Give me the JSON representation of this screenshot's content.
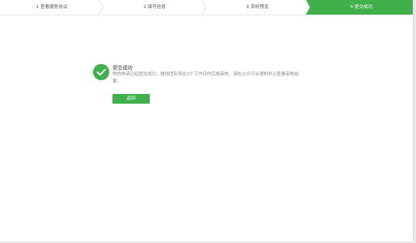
{
  "steps": [
    {
      "label": "1 查看服务协议",
      "active": false
    },
    {
      "label": "2 填写信息",
      "active": false
    },
    {
      "label": "3 资料预览",
      "active": false
    },
    {
      "label": "4 提交成功",
      "active": true
    }
  ],
  "result": {
    "icon": "checkmark-icon",
    "title": "提交成功",
    "description": "你的申请已经提交成功，微信团队将在3个工作日内完成审核，请在公众平台通知中心查看审核结果。",
    "back_label": "返回"
  },
  "colors": {
    "accent": "#3fb04a",
    "step_text": "#555555",
    "divider": "#e6e6e6"
  }
}
